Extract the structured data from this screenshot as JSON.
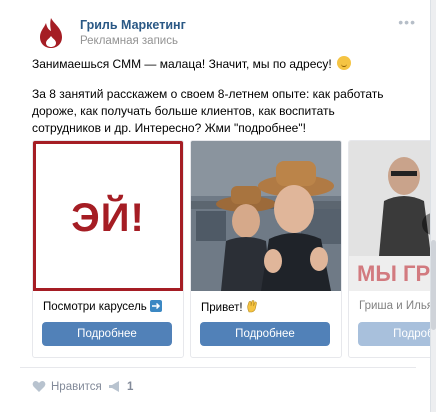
{
  "post": {
    "author": "Гриль Маркетинг",
    "subtitle": "Рекламная запись",
    "more_icon": "more-dots-icon",
    "text_line1": "Занимаешься СММ — малаца! Значит, мы по адресу!",
    "text_para2": "За 8 занятий расскажем о своем 8-летнем опыте: как работать дороже, как получать больше клиентов, как воспитать сотрудников и др. Интересно? Жми \"подробнее\"!"
  },
  "carousel": {
    "cards": [
      {
        "image_text": "ЭЙ!",
        "title": "Посмотри карусель",
        "button": "Подробнее"
      },
      {
        "title": "Привет!",
        "button": "Подробнее"
      },
      {
        "image_text": "МЫ ГРИ",
        "title": "Гриша и Илья",
        "button": "Подробнее"
      }
    ]
  },
  "footer": {
    "like_label": "Нравится",
    "share_count": "1"
  },
  "colors": {
    "brand_red": "#a51d24",
    "link_blue": "#2a5885",
    "button_blue": "#5181b8"
  }
}
